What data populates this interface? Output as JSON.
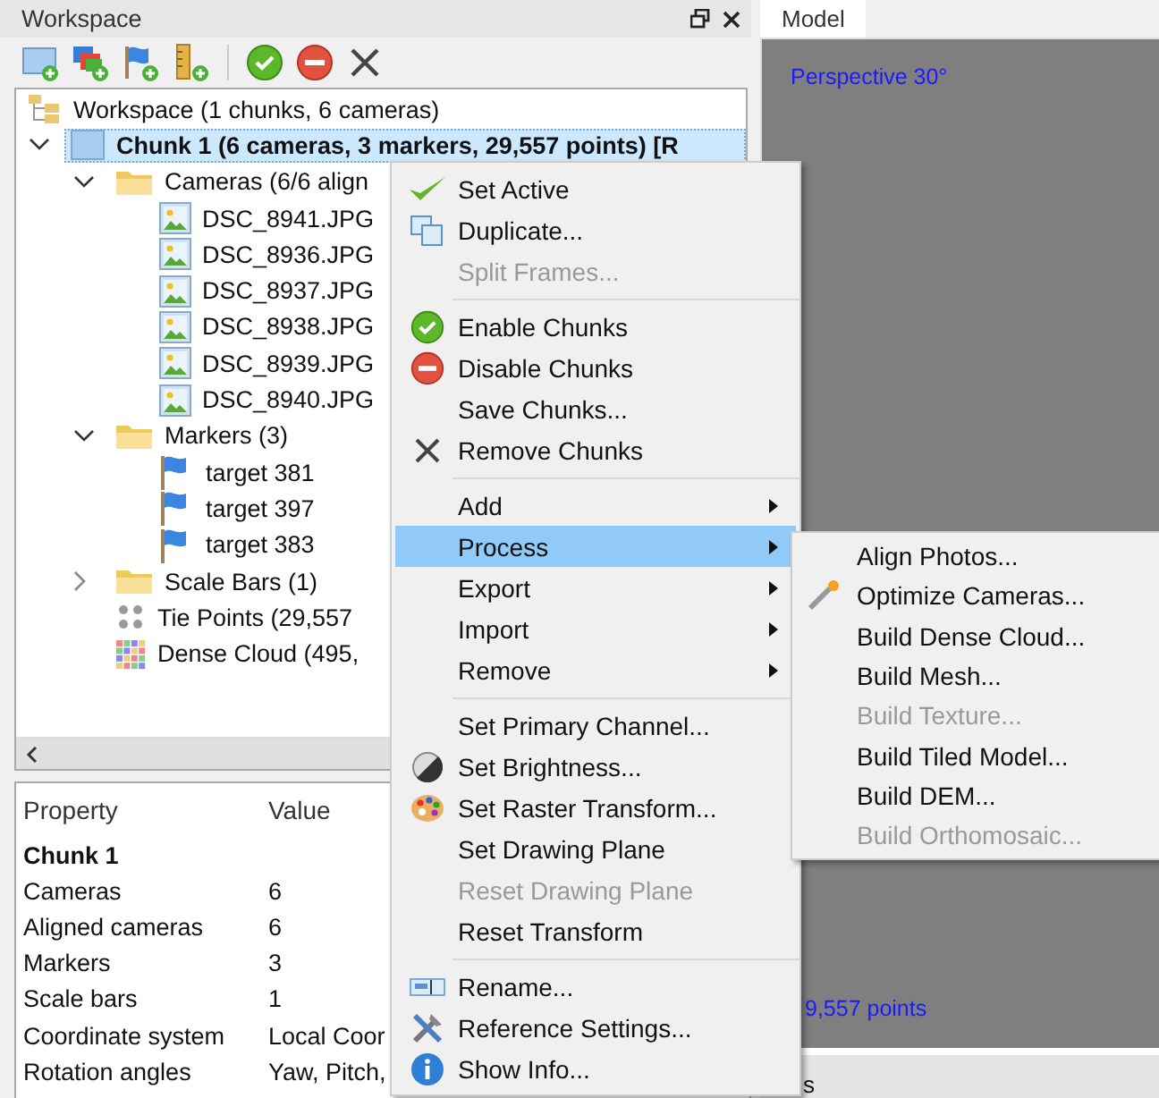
{
  "workspace_panel": {
    "title": "Workspace",
    "tree": [
      {
        "kind": "workspace",
        "label": "Workspace (1 chunks, 6 cameras)",
        "children": [
          {
            "kind": "chunk",
            "label": "Chunk 1 (6 cameras, 3 markers, 29,557 points) [R",
            "expanded": true,
            "selected": true,
            "children": [
              {
                "kind": "folder",
                "label": "Cameras (6/6 align",
                "expanded": true,
                "selected": false,
                "children": [
                  {
                    "kind": "photo",
                    "label": "DSC_8941.JPG",
                    "selected": false
                  },
                  {
                    "kind": "photo",
                    "label": "DSC_8936.JPG",
                    "selected": false
                  },
                  {
                    "kind": "photo",
                    "label": "DSC_8937.JPG",
                    "selected": false
                  },
                  {
                    "kind": "photo",
                    "label": "DSC_8938.JPG",
                    "selected": false
                  },
                  {
                    "kind": "photo",
                    "label": "DSC_8939.JPG",
                    "selected": false
                  },
                  {
                    "kind": "photo",
                    "label": "DSC_8940.JPG",
                    "selected": false
                  }
                ]
              },
              {
                "kind": "folder",
                "label": "Markers (3)",
                "expanded": true,
                "selected": false,
                "children": [
                  {
                    "kind": "marker",
                    "label": "target 381",
                    "selected": false
                  },
                  {
                    "kind": "marker",
                    "label": "target 397",
                    "selected": false
                  },
                  {
                    "kind": "marker",
                    "label": "target 383",
                    "selected": false
                  }
                ]
              },
              {
                "kind": "folder",
                "label": "Scale Bars (1)",
                "expanded": false,
                "selected": false
              },
              {
                "kind": "points",
                "label": "Tie Points (29,557",
                "selected": false
              },
              {
                "kind": "cloud",
                "label": "Dense Cloud (495,",
                "selected": false
              }
            ]
          }
        ]
      }
    ]
  },
  "properties": {
    "columns": [
      "Property",
      "Value"
    ],
    "rows": [
      {
        "kind": "heading",
        "property": "Chunk 1"
      },
      {
        "kind": "row",
        "property": "Cameras",
        "value": "6"
      },
      {
        "kind": "row",
        "property": "Aligned cameras",
        "value": "6"
      },
      {
        "kind": "row",
        "property": "Markers",
        "value": "3"
      },
      {
        "kind": "row",
        "property": "Scale bars",
        "value": "1"
      },
      {
        "kind": "row",
        "property": "Coordinate system",
        "value": "Local Coor"
      },
      {
        "kind": "row",
        "property": "Rotation angles",
        "value": "Yaw, Pitch,"
      }
    ]
  },
  "model_view": {
    "tab": "Model",
    "projection": "Perspective 30°",
    "points": "9,557 points",
    "bottom_tab": "s"
  },
  "context_menu": [
    {
      "kind": "item",
      "label": "Set Active",
      "disabled": false,
      "selected": false,
      "submenu": false
    },
    {
      "kind": "item",
      "label": "Duplicate...",
      "disabled": false,
      "selected": false,
      "submenu": false
    },
    {
      "kind": "item",
      "label": "Split Frames...",
      "disabled": true,
      "selected": false,
      "submenu": false
    },
    {
      "kind": "separator"
    },
    {
      "kind": "item",
      "label": "Enable Chunks",
      "disabled": false,
      "selected": false,
      "submenu": false
    },
    {
      "kind": "item",
      "label": "Disable Chunks",
      "disabled": false,
      "selected": false,
      "submenu": false
    },
    {
      "kind": "item",
      "label": "Save Chunks...",
      "disabled": false,
      "selected": false,
      "submenu": false
    },
    {
      "kind": "item",
      "label": "Remove Chunks",
      "disabled": false,
      "selected": false,
      "submenu": false
    },
    {
      "kind": "separator"
    },
    {
      "kind": "item",
      "label": "Add",
      "disabled": false,
      "selected": false,
      "submenu": true
    },
    {
      "kind": "item",
      "label": "Process",
      "disabled": false,
      "selected": true,
      "submenu": true
    },
    {
      "kind": "item",
      "label": "Export",
      "disabled": false,
      "selected": false,
      "submenu": true
    },
    {
      "kind": "item",
      "label": "Import",
      "disabled": false,
      "selected": false,
      "submenu": true
    },
    {
      "kind": "item",
      "label": "Remove",
      "disabled": false,
      "selected": false,
      "submenu": true
    },
    {
      "kind": "separator"
    },
    {
      "kind": "item",
      "label": "Set Primary Channel...",
      "disabled": false,
      "selected": false,
      "submenu": false
    },
    {
      "kind": "item",
      "label": "Set Brightness...",
      "disabled": false,
      "selected": false,
      "submenu": false
    },
    {
      "kind": "item",
      "label": "Set Raster Transform...",
      "disabled": false,
      "selected": false,
      "submenu": false
    },
    {
      "kind": "item",
      "label": "Set Drawing Plane",
      "disabled": false,
      "selected": false,
      "submenu": false
    },
    {
      "kind": "item",
      "label": "Reset Drawing Plane",
      "disabled": true,
      "selected": false,
      "submenu": false
    },
    {
      "kind": "item",
      "label": "Reset Transform",
      "disabled": false,
      "selected": false,
      "submenu": false
    },
    {
      "kind": "separator"
    },
    {
      "kind": "item",
      "label": "Rename...",
      "disabled": false,
      "selected": false,
      "submenu": false
    },
    {
      "kind": "item",
      "label": "Reference Settings...",
      "disabled": false,
      "selected": false,
      "submenu": false
    },
    {
      "kind": "item",
      "label": "Show Info...",
      "disabled": false,
      "selected": false,
      "submenu": false
    }
  ],
  "process_submenu": [
    {
      "label": "Align Photos...",
      "disabled": false
    },
    {
      "label": "Optimize Cameras...",
      "disabled": false
    },
    {
      "label": "Build Dense Cloud...",
      "disabled": false
    },
    {
      "label": "Build Mesh...",
      "disabled": false
    },
    {
      "label": "Build Texture...",
      "disabled": true
    },
    {
      "label": "Build Tiled Model...",
      "disabled": false
    },
    {
      "label": "Build DEM...",
      "disabled": false
    },
    {
      "label": "Build Orthomosaic...",
      "disabled": true
    }
  ]
}
